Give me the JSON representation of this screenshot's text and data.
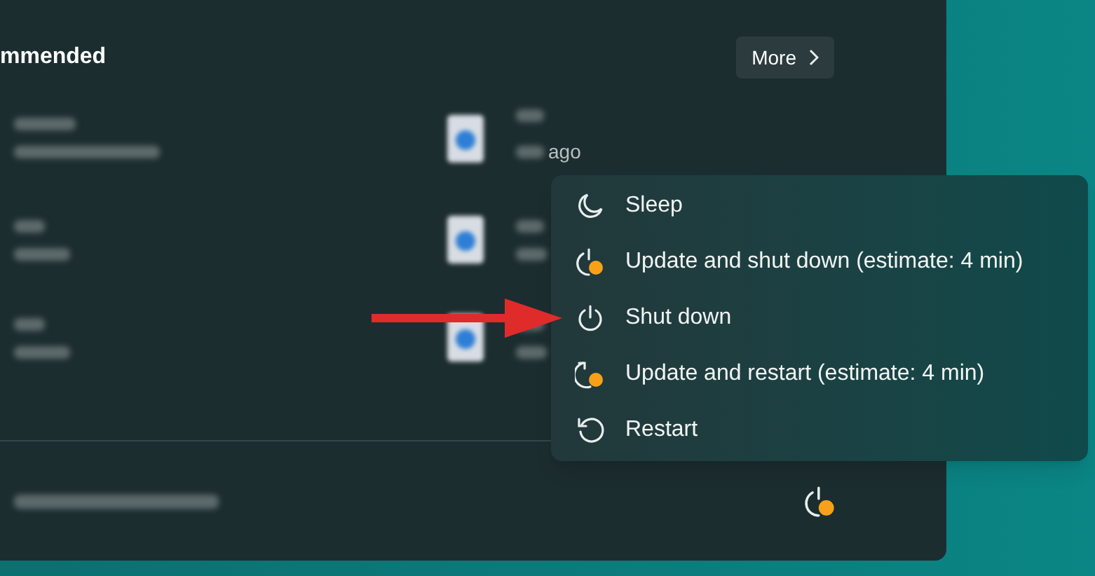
{
  "recommended": {
    "title": "mmended",
    "more_button": "More"
  },
  "partial_caption": "ago",
  "power_menu": {
    "items": [
      {
        "kind": "sleep",
        "label": "Sleep"
      },
      {
        "kind": "update_shutdown",
        "label": "Update and shut down (estimate: 4 min)"
      },
      {
        "kind": "shutdown",
        "label": "Shut down"
      },
      {
        "kind": "update_restart",
        "label": "Update and restart (estimate: 4 min)"
      },
      {
        "kind": "restart",
        "label": "Restart"
      }
    ]
  }
}
